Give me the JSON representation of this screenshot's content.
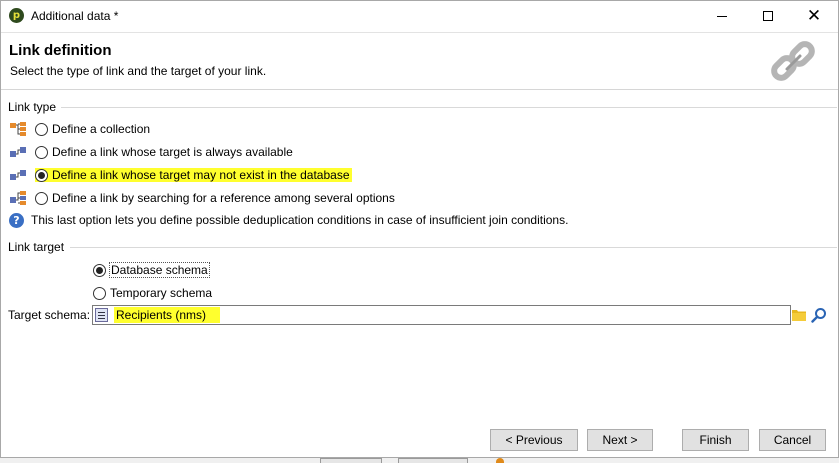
{
  "window": {
    "title": "Additional data *",
    "app_icon_letter": "p"
  },
  "header": {
    "title": "Link definition",
    "subtitle": "Select the type of link and the target of your link."
  },
  "link_type": {
    "group_label": "Link type",
    "options": [
      {
        "label": "Define a collection",
        "checked": false
      },
      {
        "label": "Define a link whose target is always available",
        "checked": false
      },
      {
        "label": "Define a link whose target may not exist in the database",
        "checked": true
      },
      {
        "label": "Define a link by searching for a reference among several options",
        "checked": false
      }
    ],
    "info_text": "This last option lets you define possible deduplication conditions in case of insufficient join conditions."
  },
  "link_target": {
    "group_label": "Link target",
    "options": [
      {
        "label": "Database schema",
        "checked": true
      },
      {
        "label": "Temporary schema",
        "checked": false
      }
    ],
    "schema_label": "Target schema:",
    "schema_value": "Recipients (nms)"
  },
  "buttons": {
    "previous": "< Previous",
    "next": "Next >",
    "finish": "Finish",
    "cancel": "Cancel"
  },
  "colors": {
    "highlight": "#ffff2e",
    "info_blue": "#3a6fc4"
  }
}
